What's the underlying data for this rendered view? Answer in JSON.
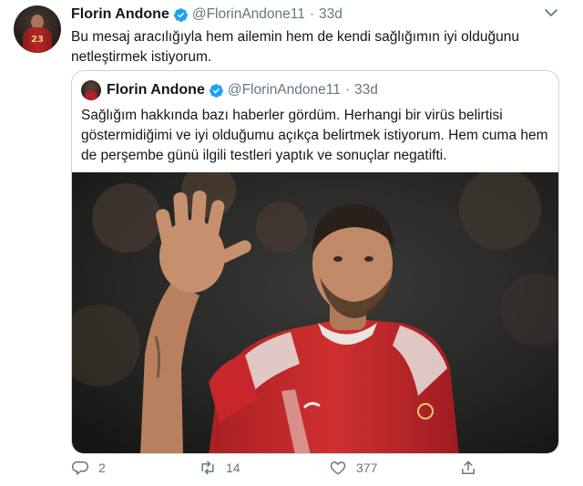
{
  "tweet": {
    "author": "Florin Andone",
    "handle": "@FlorinAndone11",
    "separator": "·",
    "time": "33d",
    "avatar_number": "23",
    "text": "Bu mesaj aracılığıyla hem ailemin hem de kendi sağlığımın iyi olduğunu netleştirmek istiyorum.",
    "verified_icon": "verified-badge-icon",
    "more_icon": "chevron-down-icon"
  },
  "quoted": {
    "author": "Florin Andone",
    "handle": "@FlorinAndone11",
    "separator": "·",
    "time": "33d",
    "text": "Sağlığım hakkında bazı haberler gördüm. Herhangi bir virüs belirtisi göstermidiğimi ve iyi olduğumu açıkça belirtmek istiyorum. Hem cuma hem de perşembe günü ilgili testleri yaptık ve sonuçlar negatifti.",
    "photo_icon": "player-waving-photo"
  },
  "actions": {
    "reply": {
      "icon": "reply-icon",
      "count": "2"
    },
    "retweet": {
      "icon": "retweet-icon",
      "count": "14"
    },
    "like": {
      "icon": "like-icon",
      "count": "377"
    },
    "share": {
      "icon": "share-icon"
    }
  },
  "colors": {
    "text": "#14171a",
    "secondary": "#657786",
    "border": "#ccd6dd",
    "verified": "#1da1f2",
    "jersey_red": "#c8262c"
  }
}
